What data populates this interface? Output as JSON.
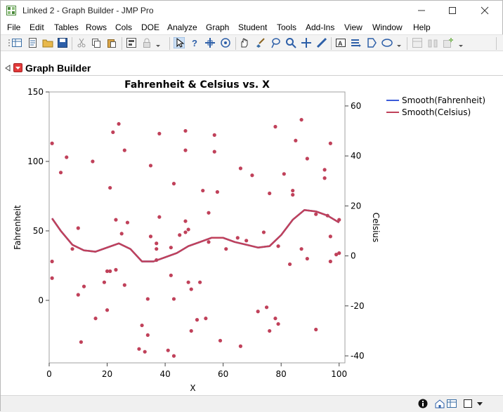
{
  "window": {
    "title": "Linked 2 - Graph Builder - JMP Pro"
  },
  "menu": [
    "File",
    "Edit",
    "Tables",
    "Rows",
    "Cols",
    "DOE",
    "Analyze",
    "Graph",
    "Student",
    "Tools",
    "Add-Ins",
    "View",
    "Window",
    "Help"
  ],
  "outline": {
    "title": "Graph Builder"
  },
  "colors": {
    "fahrenheit_line": "#3b5bd9",
    "celsius_line": "#c0415a",
    "points": "#c0415a"
  },
  "chart_data": {
    "type": "scatter",
    "title": "Fahrenheit & Celsius vs. X",
    "xlabel": "X",
    "ylabel": "Fahrenheit",
    "y2label": "Celsius",
    "xlim": [
      0,
      102
    ],
    "ylim": [
      -45,
      150
    ],
    "y2lim": [
      -42.8,
      65.6
    ],
    "xticks": [
      0,
      20,
      40,
      60,
      80,
      100
    ],
    "yticks": [
      0,
      50,
      100,
      150
    ],
    "y2ticks": [
      -40,
      -20,
      0,
      20,
      40,
      60
    ],
    "legend": [
      "Smooth(Fahrenheit)",
      "Smooth(Celsius)"
    ],
    "legend_position": "right",
    "points": [
      [
        1,
        113
      ],
      [
        1,
        28
      ],
      [
        1,
        16
      ],
      [
        4,
        92
      ],
      [
        6,
        103
      ],
      [
        8,
        37
      ],
      [
        10,
        52
      ],
      [
        10,
        4
      ],
      [
        11,
        -30
      ],
      [
        12,
        10
      ],
      [
        15,
        100
      ],
      [
        16,
        -13
      ],
      [
        19,
        13
      ],
      [
        20,
        21
      ],
      [
        20,
        -7
      ],
      [
        21,
        21
      ],
      [
        21,
        81
      ],
      [
        22,
        121
      ],
      [
        23,
        22
      ],
      [
        23,
        58
      ],
      [
        24,
        127
      ],
      [
        25,
        48
      ],
      [
        26,
        108
      ],
      [
        26,
        11
      ],
      [
        27,
        56
      ],
      [
        31,
        -35
      ],
      [
        32,
        -18
      ],
      [
        33,
        -37
      ],
      [
        34,
        -25
      ],
      [
        34,
        1
      ],
      [
        35,
        46
      ],
      [
        35,
        97
      ],
      [
        37,
        37
      ],
      [
        37,
        29
      ],
      [
        38,
        60
      ],
      [
        38,
        120
      ],
      [
        37,
        41
      ],
      [
        41,
        -36
      ],
      [
        42,
        18
      ],
      [
        42,
        38
      ],
      [
        43,
        84
      ],
      [
        43,
        1
      ],
      [
        43,
        -40
      ],
      [
        45,
        47
      ],
      [
        47,
        122
      ],
      [
        47,
        108
      ],
      [
        47,
        49
      ],
      [
        47,
        57
      ],
      [
        48,
        51
      ],
      [
        48,
        13
      ],
      [
        49,
        8
      ],
      [
        49,
        -22
      ],
      [
        51,
        -14
      ],
      [
        52,
        13
      ],
      [
        53,
        79
      ],
      [
        54,
        -13
      ],
      [
        55,
        63
      ],
      [
        55,
        42
      ],
      [
        57,
        119
      ],
      [
        57,
        107
      ],
      [
        58,
        78
      ],
      [
        59,
        -29
      ],
      [
        61,
        37
      ],
      [
        65,
        45
      ],
      [
        66,
        -33
      ],
      [
        66,
        95
      ],
      [
        68,
        43
      ],
      [
        70,
        90
      ],
      [
        72,
        -8
      ],
      [
        74,
        49
      ],
      [
        75,
        -5
      ],
      [
        76,
        77
      ],
      [
        76,
        -22
      ],
      [
        78,
        125
      ],
      [
        78,
        -13
      ],
      [
        79,
        39
      ],
      [
        79,
        -17
      ],
      [
        81,
        91
      ],
      [
        83,
        26
      ],
      [
        84,
        79
      ],
      [
        84,
        76
      ],
      [
        85,
        115
      ],
      [
        87,
        130
      ],
      [
        87,
        37
      ],
      [
        89,
        102
      ],
      [
        89,
        30
      ],
      [
        92,
        62
      ],
      [
        92,
        -21
      ],
      [
        95,
        94
      ],
      [
        95,
        88
      ],
      [
        96,
        61
      ],
      [
        97,
        113
      ],
      [
        97,
        46
      ],
      [
        97,
        28
      ],
      [
        99,
        33
      ],
      [
        100,
        58
      ],
      [
        100,
        34
      ]
    ],
    "smooth_x": [
      1,
      4,
      8,
      12,
      16,
      20,
      24,
      28,
      32,
      36,
      40,
      44,
      48,
      52,
      56,
      60,
      64,
      68,
      72,
      76,
      80,
      84,
      88,
      92,
      96,
      100
    ],
    "smooth_fahrenheit": [
      59,
      50,
      40,
      36,
      35,
      38,
      41,
      37,
      28,
      28,
      31,
      34,
      39,
      42,
      45,
      45,
      42,
      40,
      38,
      39,
      47,
      58,
      65,
      64,
      61,
      56
    ]
  },
  "status": {
    "info_icon": "info-icon",
    "home_icon": "home-icon",
    "window_icon": "window-icon"
  }
}
